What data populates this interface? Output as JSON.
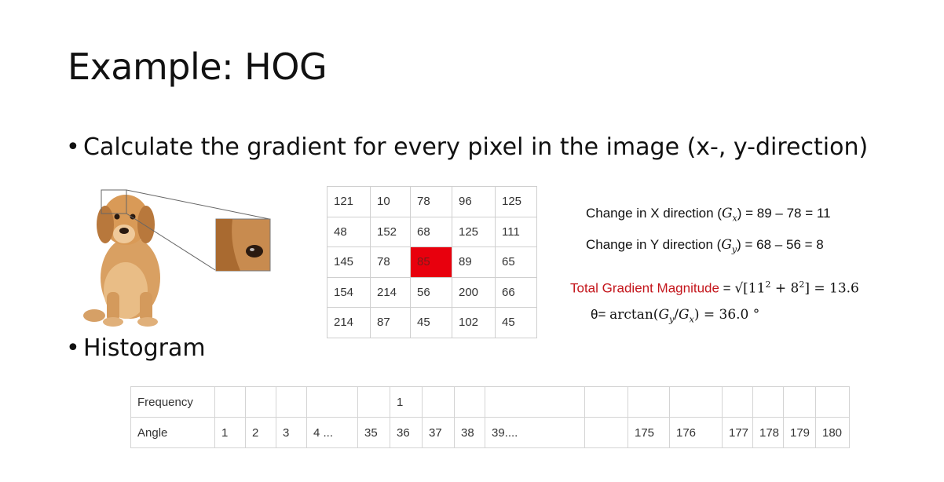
{
  "slide": {
    "title": "Example: HOG",
    "bullet_dot": "•",
    "bullet1": "Calculate the gradient for every pixel in the image (x-, y-direction)",
    "bullet2": "Histogram"
  },
  "pixel_grid": {
    "rows": [
      [
        "121",
        "10",
        "78",
        "96",
        "125"
      ],
      [
        "48",
        "152",
        "68",
        "125",
        "111"
      ],
      [
        "145",
        "78",
        "85",
        "89",
        "65"
      ],
      [
        "154",
        "214",
        "56",
        "200",
        "66"
      ],
      [
        "214",
        "87",
        "45",
        "102",
        "45"
      ]
    ],
    "highlight_color": "#e8000d"
  },
  "equations": {
    "eq1_text": "Change in X direction (",
    "eq1_var": "G",
    "eq1_sub": "x",
    "eq1_rest": ") = 89 – 78 = 11",
    "eq2_text": "Change in Y direction (",
    "eq2_var": "G",
    "eq2_sub": "y",
    "eq2_rest": ") = 68 – 56 = 8",
    "eq3_label": "Total Gradient Magnitude",
    "eq3_eq": " = ",
    "eq3_sqrt": "√[11",
    "eq3_sup1": "2",
    "eq3_plus": " + 8",
    "eq3_sup2": "2",
    "eq3_close": "]",
    "eq3_result": " = 13.6",
    "eq4_theta": "θ= ",
    "eq4_fn": "arctan(",
    "eq4_g1": "G",
    "eq4_s1": "y",
    "eq4_slash": "/",
    "eq4_g2": "G",
    "eq4_s2": "x",
    "eq4_rest": ") = 36.0 °",
    "label_color": "#c4161c"
  },
  "histogram": {
    "row_labels": [
      "Frequency",
      "Angle"
    ],
    "frequency": [
      "",
      "",
      "",
      "",
      "",
      "1",
      "",
      "",
      "",
      "",
      "",
      "",
      "",
      "",
      "",
      ""
    ],
    "angles": [
      "1",
      "2",
      "3",
      "4 ...",
      "35",
      "36",
      "37",
      "38",
      "39....",
      "",
      "175",
      "176",
      "177",
      "178",
      "179",
      "180"
    ]
  }
}
